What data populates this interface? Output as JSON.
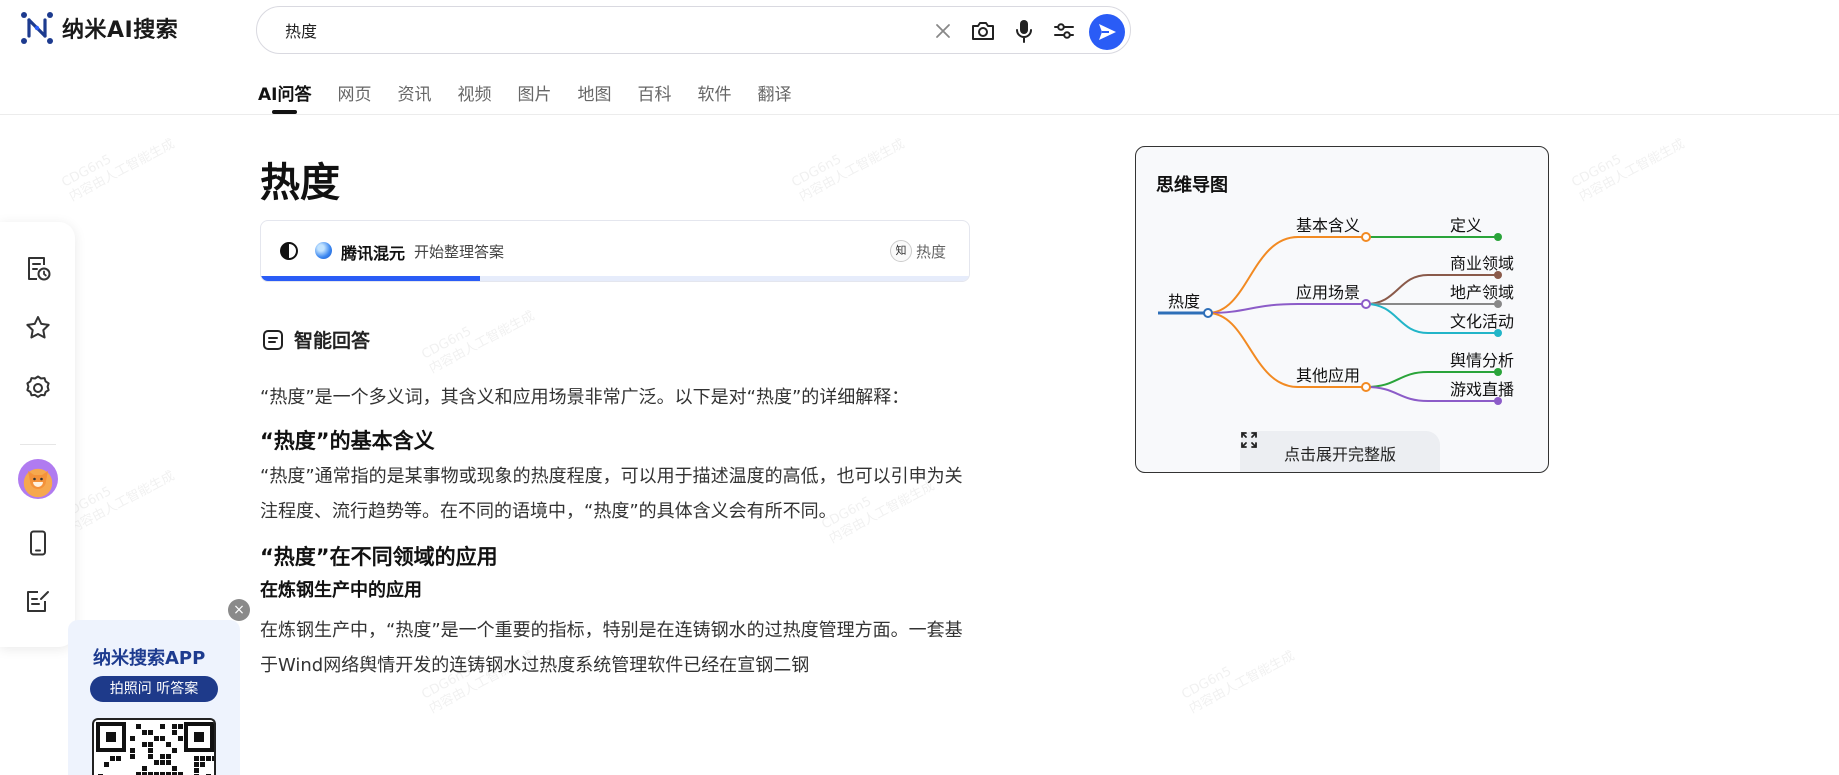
{
  "app": {
    "name": "纳米AI搜索"
  },
  "search": {
    "query": "热度"
  },
  "tabs": [
    "AI问答",
    "网页",
    "资讯",
    "视频",
    "图片",
    "地图",
    "百科",
    "软件",
    "翻译"
  ],
  "question_title": "热度",
  "status": {
    "model_name": "腾讯混元",
    "message": "开始整理答案",
    "source_icon_text": "知",
    "source_label": "热度",
    "progress": 0.31
  },
  "answer": {
    "section_label": "智能回答",
    "intro": "“热度”是一个多义词，其含义和应用场景非常广泛。以下是对“热度”的详细解释：",
    "h_basic": "“热度”的基本含义",
    "p_basic": "“热度”通常指的是某事物或现象的热度程度，可以用于描述温度的高低，也可以引申为关注程度、流行趋势等。在不同的语境中，“热度”的具体含义会有所不同。",
    "h_fields": "“热度”在不同领域的应用",
    "h_steel": "在炼钢生产中的应用",
    "p_steel": "在炼钢生产中，“热度”是一个重要的指标，特别是在连铸钢水的过热度管理方面。一套基于Wind网络舆情开发的连铸钢水过热度系统管理软件已经在宣钢二钢"
  },
  "mindmap": {
    "title": "思维导图",
    "root": "热度",
    "branches": [
      {
        "label": "基本含义",
        "color": "#f28a22",
        "children": [
          {
            "label": "定义",
            "color": "#2aa43a"
          }
        ]
      },
      {
        "label": "应用场景",
        "color": "#8c5cc8",
        "children": [
          {
            "label": "商业领域",
            "color": "#8a5a4a"
          },
          {
            "label": "地产领域",
            "color": "#888888"
          },
          {
            "label": "文化活动",
            "color": "#22b5c8"
          }
        ]
      },
      {
        "label": "其他应用",
        "color": "#f28a22",
        "children": [
          {
            "label": "舆情分析",
            "color": "#2aa43a"
          },
          {
            "label": "游戏直播",
            "color": "#8c5cc8"
          }
        ]
      }
    ],
    "expand_label": "点击展开完整版"
  },
  "app_promo": {
    "title": "纳米搜索APP",
    "tagline": "拍照问 听答案",
    "close_symbol": "×"
  },
  "watermark": {
    "line1": "CDG6n5",
    "line2": "内容由人工智能生成"
  }
}
